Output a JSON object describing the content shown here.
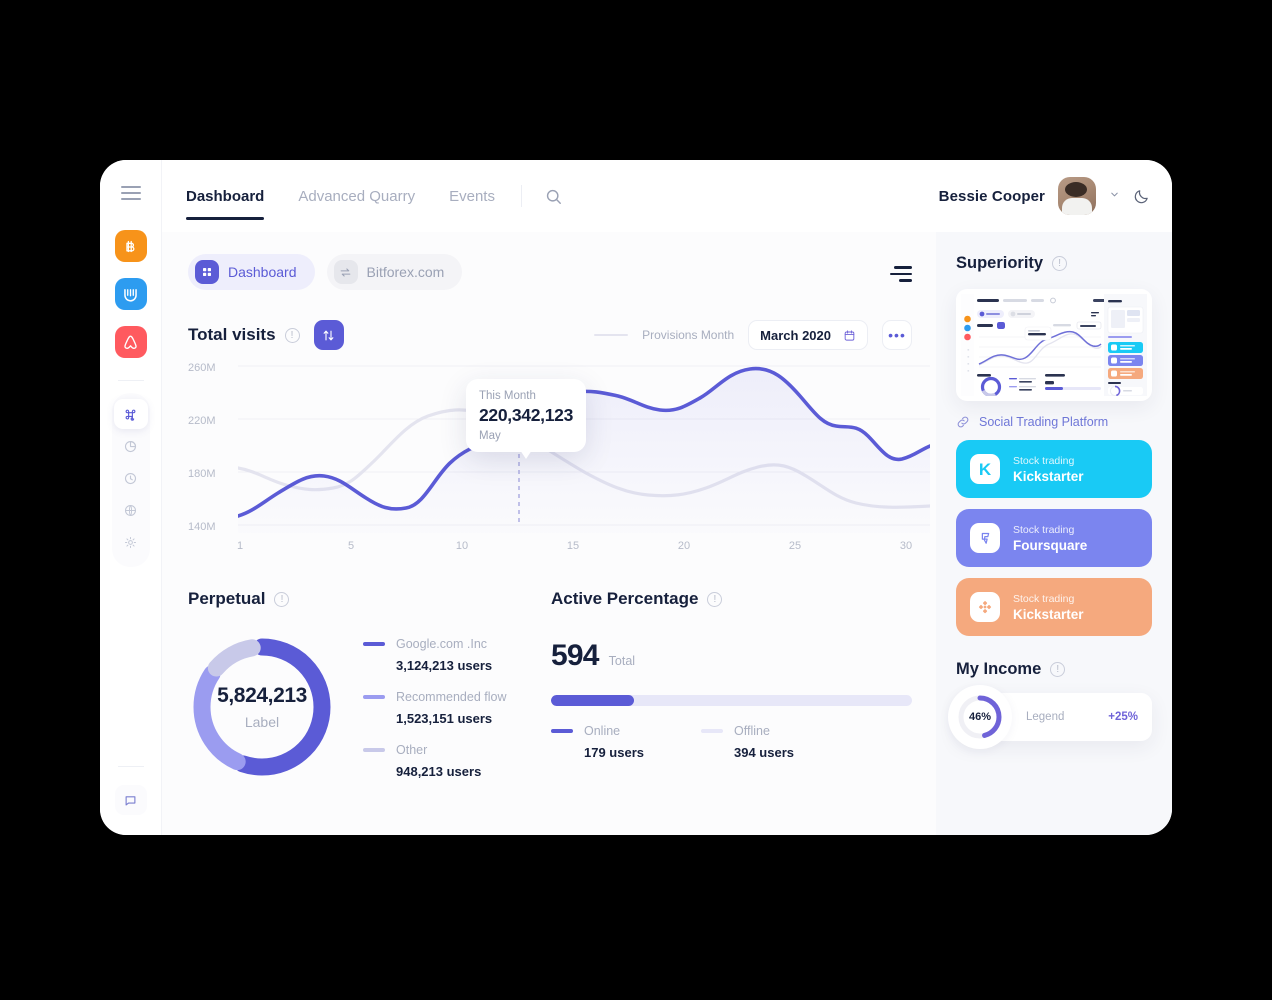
{
  "window": {
    "rail": {
      "menu_icon": "hamburger-icon",
      "brands": [
        {
          "name": "bitcoin",
          "glyph": "₿",
          "color": "#F7931A"
        },
        {
          "name": "crypto-exchange",
          "glyph": "‖",
          "color": "#2D9CF0"
        },
        {
          "name": "airbnb",
          "glyph": "Ⓐ",
          "color": "#FF5A5F"
        }
      ],
      "nav": [
        {
          "name": "command-icon",
          "active": true
        },
        {
          "name": "pie-chart-icon",
          "active": false
        },
        {
          "name": "clock-icon",
          "active": false
        },
        {
          "name": "globe-icon",
          "active": false
        },
        {
          "name": "settings-icon",
          "active": false
        }
      ],
      "bottom_icon": "chat-icon"
    },
    "topbar": {
      "tabs": [
        {
          "label": "Dashboard",
          "active": true
        },
        {
          "label": "Advanced Quarry",
          "active": false
        },
        {
          "label": "Events",
          "active": false
        }
      ],
      "search_icon": "search-icon",
      "user_name": "Bessie Cooper",
      "chevron": "⌄",
      "theme_icon": "moon-icon"
    },
    "chips": [
      {
        "label": "Dashboard",
        "icon": "grid-icon",
        "active": true
      },
      {
        "label": "Bitforex.com",
        "icon": "transfer-icon",
        "active": false
      }
    ],
    "filter_icon": "filter-lines-icon",
    "total_visits": {
      "title": "Total visits",
      "sort_icon": "sort-updown-icon",
      "legend_label": "Provisions Month",
      "date_value": "March 2020",
      "calendar_icon": "calendar-icon",
      "more_label": "•••",
      "tooltip": {
        "header": "This Month",
        "value": "220,342,123",
        "month": "May"
      }
    },
    "perpetual": {
      "title": "Perpetual",
      "center_value": "5,824,213",
      "center_label": "Label",
      "legend": [
        {
          "name": "Google.com .Inc",
          "value": "3,124,213 users",
          "color": "#5b5bd6"
        },
        {
          "name": "Recommended flow",
          "value": "1,523,151 users",
          "color": "#9b9cf0"
        },
        {
          "name": "Other",
          "value": "948,213 users",
          "color": "#c8c9e9"
        }
      ]
    },
    "active_percentage": {
      "title": "Active Percentage",
      "total_value": "594",
      "total_label": "Total",
      "fill_percent": 23,
      "legend": [
        {
          "name": "Online",
          "value": "179 users",
          "color": "#5b5bd6"
        },
        {
          "name": "Offline",
          "value": "394 users",
          "color": "#e7e7f8"
        }
      ]
    },
    "sidebar": {
      "superiority_title": "Superiority",
      "link_text": "Social Trading Platform",
      "link_icon": "link-icon",
      "promos": [
        {
          "sub": "Stock trading",
          "name": "Kickstarter",
          "bg": "#19CAF5",
          "glyph": "K",
          "glyph_color": "#19CAF5"
        },
        {
          "sub": "Stock trading",
          "name": "Foursquare",
          "bg": "#7b85ef",
          "glyph": "F",
          "glyph_color": "#7b85ef"
        },
        {
          "sub": "Stock trading",
          "name": "Kickstarter",
          "bg": "#F5A97E",
          "glyph": "◈",
          "glyph_color": "#F5A97E"
        }
      ],
      "income_title": "My Income",
      "income": {
        "percent_label": "46%",
        "percent_value": 46,
        "legend": "Legend",
        "delta": "+25%"
      }
    }
  },
  "chart_data": {
    "type": "line",
    "title": "Total visits",
    "xlabel": "",
    "ylabel": "",
    "ylim": [
      140,
      270
    ],
    "xlim": [
      1,
      30
    ],
    "ytick_labels": [
      "260M",
      "220M",
      "180M",
      "140M"
    ],
    "ytick_values": [
      260,
      220,
      180,
      140
    ],
    "xtick_labels": [
      "1",
      "5",
      "10",
      "15",
      "20",
      "25",
      "30"
    ],
    "xtick_values": [
      1,
      5,
      10,
      15,
      20,
      25,
      30
    ],
    "grid": true,
    "legend_position": "top-right",
    "highlight_point": {
      "x": 13,
      "y": 205,
      "label": "220,342,123",
      "month": "May"
    },
    "series": [
      {
        "name": "This Month",
        "color": "#5b5bd6",
        "x": [
          1,
          2,
          3,
          4.5,
          6,
          7.5,
          9,
          10.5,
          12,
          13,
          14.5,
          16,
          17.5,
          19,
          20.5,
          22.5,
          24,
          25.5,
          27,
          28,
          29,
          30
        ],
        "values": [
          147,
          152,
          163,
          175,
          172,
          162,
          157,
          186,
          196,
          205,
          222,
          230,
          229,
          215,
          228,
          250,
          243,
          212,
          209,
          180,
          190,
          193
        ]
      },
      {
        "name": "Provisions Month",
        "color": "#e4e4ef",
        "x": [
          1,
          2.5,
          4,
          5.5,
          7,
          8.5,
          10,
          11.5,
          13,
          14.5,
          16,
          18,
          20,
          22,
          23.5,
          25.5,
          27,
          28.5,
          30
        ],
        "values": [
          183,
          180,
          170,
          166,
          170,
          192,
          216,
          222,
          215,
          207,
          198,
          178,
          163,
          160,
          166,
          183,
          176,
          162,
          157
        ]
      }
    ]
  }
}
